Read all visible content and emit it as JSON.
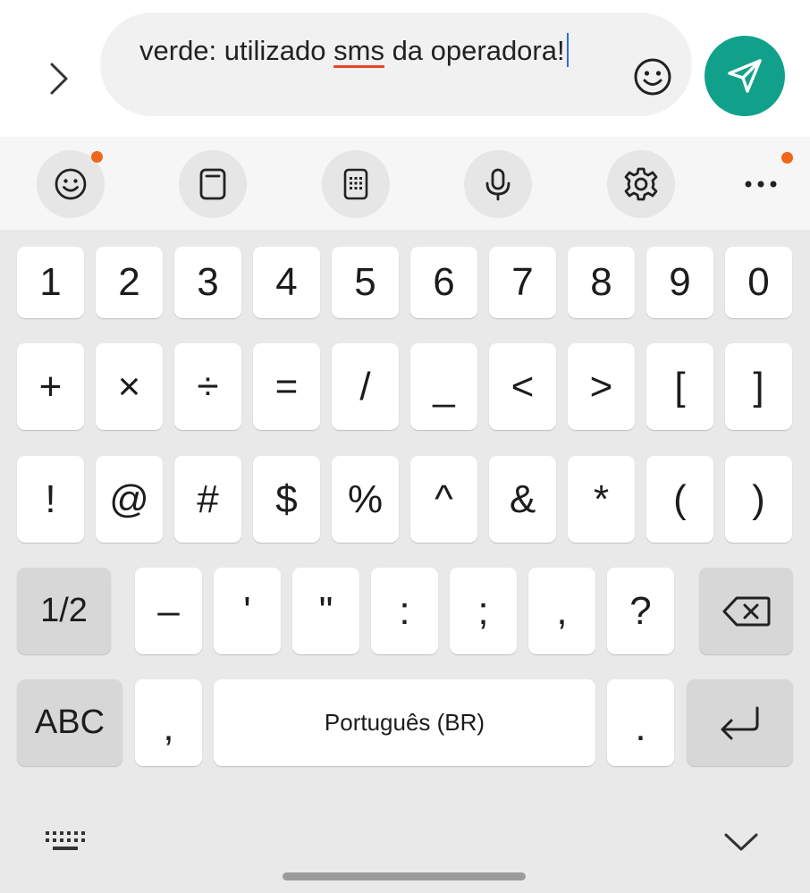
{
  "compose": {
    "text_before": "verde: utilizado ",
    "misspelled_word": "sms",
    "text_after": " da operadora!"
  },
  "colors": {
    "send_button": "#11a18a",
    "notification_dot": "#f0661a",
    "caret": "#2a6fd6",
    "misspell_underline": "#e8452c"
  },
  "toolbar": {
    "icons": [
      "emoji-icon",
      "clipboard-icon",
      "keypad-icon",
      "microphone-icon",
      "settings-icon",
      "more-icon"
    ]
  },
  "keyboard": {
    "row1": [
      "1",
      "2",
      "3",
      "4",
      "5",
      "6",
      "7",
      "8",
      "9",
      "0"
    ],
    "row2": [
      "+",
      "×",
      "÷",
      "=",
      "/",
      "_",
      "<",
      ">",
      "[",
      "]"
    ],
    "row3": [
      "!",
      "@",
      "#",
      "$",
      "%",
      "^",
      "&",
      "*",
      "(",
      ")"
    ],
    "row4_mode": "1/2",
    "row4": [
      "–",
      "'",
      "\"",
      ":",
      ";",
      ",",
      "?"
    ],
    "row5_mode": "ABC",
    "row5_comma": ",",
    "space_label": "Português (BR)",
    "row5_period": "."
  }
}
